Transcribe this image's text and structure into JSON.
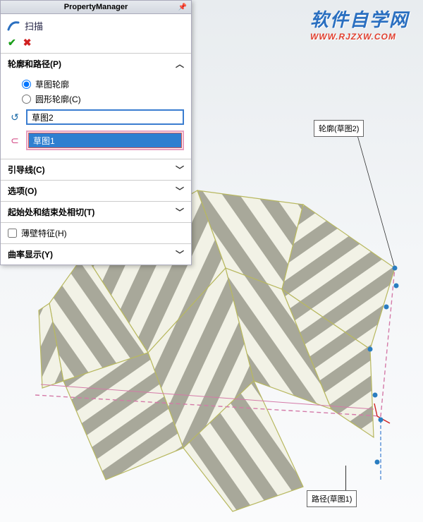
{
  "header": {
    "title": "PropertyManager"
  },
  "feature": {
    "title": "扫描"
  },
  "profile_path": {
    "label": "轮廓和路径(P)",
    "radio_sketch": "草图轮廓",
    "radio_circle": "圆形轮廓(C)",
    "profile_value": "草图2",
    "path_value": "草图1"
  },
  "guides": {
    "label": "引导线(C)"
  },
  "options": {
    "label": "选项(O)"
  },
  "tangent": {
    "label": "起始处和结束处相切(T)"
  },
  "thin": {
    "label": "薄壁特征(H)"
  },
  "curvature": {
    "label": "曲率显示(Y)"
  },
  "watermark": {
    "cn": "软件自学网",
    "url": "WWW.RJZXW.COM"
  },
  "callouts": {
    "profile": "轮廓(草图2)",
    "path": "路径(草图1)"
  }
}
